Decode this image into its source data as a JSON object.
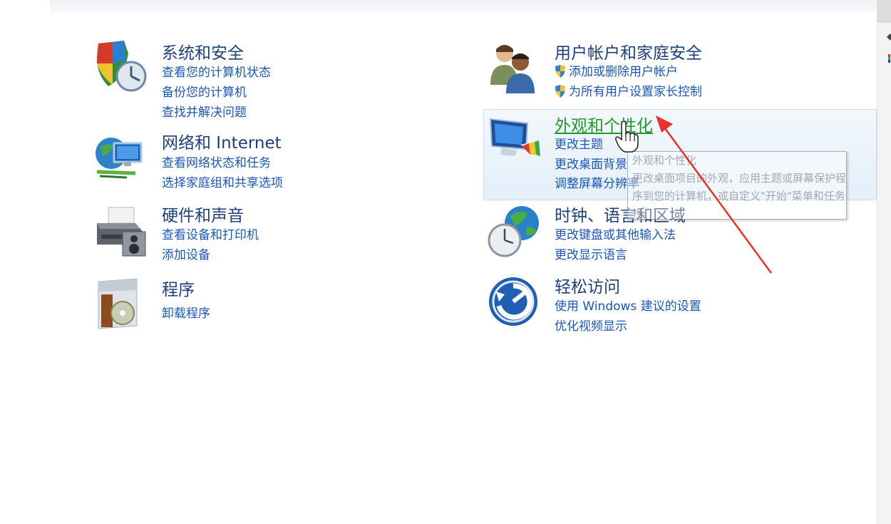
{
  "categories": {
    "system_security": {
      "title": "系统和安全",
      "links": [
        "查看您的计算机状态",
        "备份您的计算机",
        "查找并解决问题"
      ]
    },
    "network": {
      "title": "网络和 Internet",
      "links": [
        "查看网络状态和任务",
        "选择家庭组和共享选项"
      ]
    },
    "hardware_sound": {
      "title": "硬件和声音",
      "links": [
        "查看设备和打印机",
        "添加设备"
      ]
    },
    "programs": {
      "title": "程序",
      "links": [
        "卸载程序"
      ]
    },
    "user_accounts": {
      "title": "用户帐户和家庭安全",
      "links": [
        "添加或删除用户帐户",
        "为所有用户设置家长控制"
      ]
    },
    "appearance": {
      "title": "外观和个性化",
      "links": [
        "更改主题",
        "更改桌面背景",
        "调整屏幕分辨率"
      ]
    },
    "clock_region": {
      "title": "时钟、语言和区域",
      "links": [
        "更改键盘或其他输入法",
        "更改显示语言"
      ]
    },
    "ease_access": {
      "title": "轻松访问",
      "links": [
        "使用 Windows 建议的设置",
        "优化视频显示"
      ]
    }
  },
  "tooltip": {
    "title": "外观和个性化",
    "body": "更改桌面项目的外观，应用主题或屏幕保护程序到您的计算机，或自定义\"开始\"菜单和任务栏。"
  },
  "colors": {
    "category_title": "#1e3f7a",
    "link": "#1a56b8",
    "hover_title": "#1f9a2a",
    "annotation_arrow": "#e8322a"
  },
  "icons": {
    "system_security": "shield-clock-icon",
    "network": "globe-network-icon",
    "hardware_sound": "printer-icon",
    "programs": "program-box-icon",
    "user_accounts": "users-icon",
    "appearance": "monitor-palette-icon",
    "clock_region": "clock-globe-icon",
    "ease_access": "ease-of-access-icon",
    "uac": "uac-shield-icon",
    "cursor": "hand-cursor-icon",
    "annotation": "red-arrow-icon"
  }
}
